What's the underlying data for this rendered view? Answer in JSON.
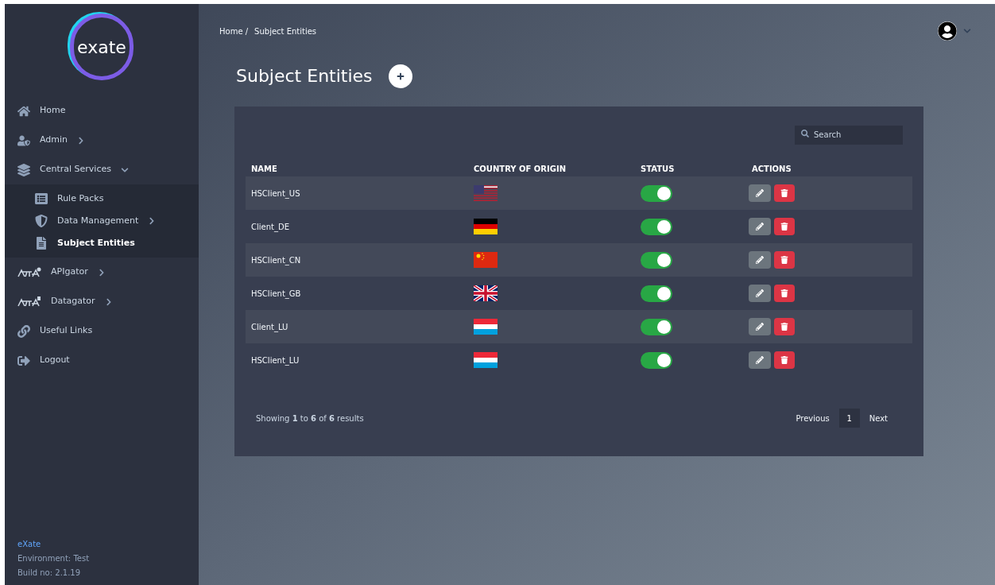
{
  "sidebar": {
    "logo": "exate",
    "items": [
      {
        "label": "Home",
        "kind": "home",
        "expandable": false,
        "selected": false
      },
      {
        "label": "Admin",
        "kind": "user-shield",
        "expandable": true,
        "expanded": false,
        "selected": false
      },
      {
        "label": "Central Services",
        "kind": "layers",
        "expandable": true,
        "expanded": true,
        "selected": false,
        "children": [
          {
            "label": "Rule Packs",
            "kind": "list",
            "expandable": false,
            "selected": false
          },
          {
            "label": "Data Management",
            "kind": "shield",
            "expandable": true,
            "expanded": false,
            "selected": false
          },
          {
            "label": "Subject Entities",
            "kind": "doc",
            "expandable": false,
            "selected": true
          }
        ]
      },
      {
        "label": "APIgator",
        "kind": "gator-cloud",
        "expandable": true,
        "expanded": false,
        "selected": false
      },
      {
        "label": "Datagator",
        "kind": "gator-db",
        "expandable": true,
        "expanded": false,
        "selected": false
      },
      {
        "label": "Useful Links",
        "kind": "link",
        "expandable": false,
        "selected": false
      },
      {
        "label": "Logout",
        "kind": "logout",
        "expandable": false,
        "selected": false
      }
    ],
    "footer": {
      "brand": "eXate",
      "environment": "Environment: Test",
      "build": "Build no: 2.1.19"
    }
  },
  "breadcrumb": [
    "Home /",
    "Subject Entities"
  ],
  "page_title": "Subject Entities",
  "search": {
    "placeholder": "Search"
  },
  "table": {
    "columns": [
      "NAME",
      "COUNTRY OF ORIGIN",
      "STATUS",
      "ACTIONS"
    ],
    "rows": [
      {
        "name": "HSClient_US",
        "kind": "us",
        "on": true
      },
      {
        "name": "Client_DE",
        "kind": "de",
        "on": true
      },
      {
        "name": "HSClient_CN",
        "kind": "cn",
        "on": true
      },
      {
        "name": "HSClient_GB",
        "kind": "gb",
        "on": true
      },
      {
        "name": "Client_LU",
        "kind": "lu",
        "on": true
      },
      {
        "name": "HSClient_LU",
        "kind": "lu",
        "on": true
      }
    ]
  },
  "summary": "Showing **1** to **6** of **6** results",
  "pagination": {
    "previous": "Previous",
    "pages": [
      {
        "label": "1",
        "selected": true
      }
    ],
    "next": "Next"
  }
}
